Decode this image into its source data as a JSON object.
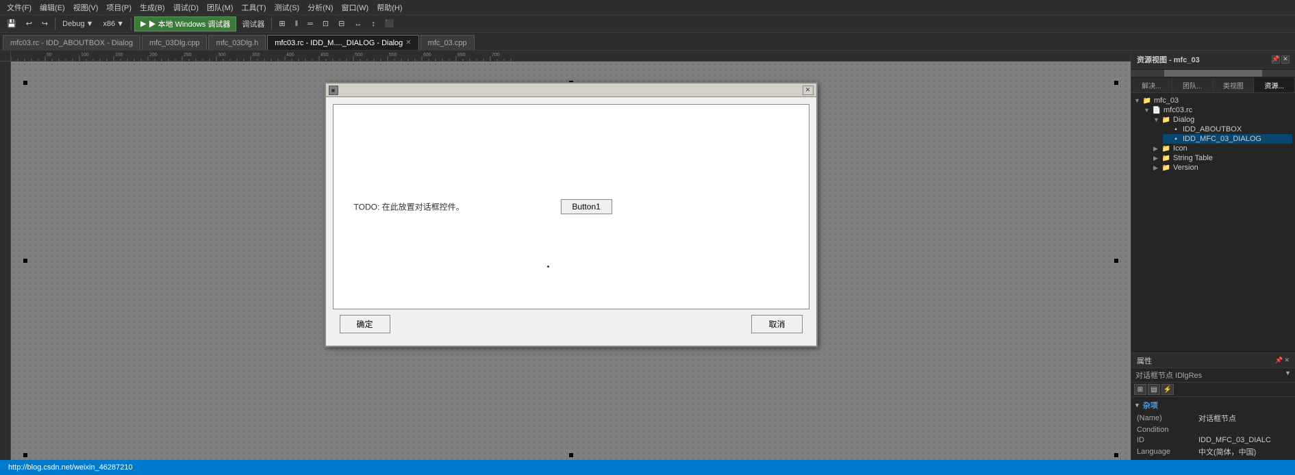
{
  "toolbar": {
    "menus": [
      "文件(F)",
      "编辑(E)",
      "视图(V)",
      "项目(P)",
      "生成(B)",
      "调试(D)",
      "团队(M)",
      "工具(T)",
      "测试(S)",
      "分析(N)",
      "窗口(W)",
      "帮助(H)"
    ],
    "debug_label": "Debug",
    "platform_label": "x86",
    "run_label": "▶ 本地 Windows 调试器",
    "attach_label": "调试器"
  },
  "tabs": [
    {
      "label": "mfc03.rc - IDD_ABOUTBOX - Dialog",
      "active": false,
      "closable": false
    },
    {
      "label": "mfc_03Dlg.cpp",
      "active": false,
      "closable": false
    },
    {
      "label": "mfc_03Dlg.h",
      "active": false,
      "closable": false
    },
    {
      "label": "mfc03.rc - IDD_M...._DIALOG - Dialog",
      "active": true,
      "closable": true
    },
    {
      "label": "mfc_03.cpp",
      "active": false,
      "closable": false
    }
  ],
  "dialog": {
    "title": "",
    "todo_text": "TODO: 在此放置对话框控件。",
    "button1_label": "Button1",
    "ok_label": "确定",
    "cancel_label": "取消"
  },
  "sidebar": {
    "title": "资源视图 - mfc_03",
    "tabs": [
      "解决...",
      "团队...",
      "类视图",
      "资源..."
    ],
    "active_tab": "资源...",
    "tree": {
      "root": "mfc_03",
      "items": [
        {
          "label": "mfc03.rc",
          "expanded": true,
          "children": [
            {
              "label": "Dialog",
              "expanded": true,
              "children": [
                {
                  "label": "IDD_ABOUTBOX"
                },
                {
                  "label": "IDD_MFC_03_DIALOG",
                  "selected": true
                }
              ]
            },
            {
              "label": "Icon",
              "expanded": false
            },
            {
              "label": "String Table",
              "expanded": false
            },
            {
              "label": "Version",
              "expanded": false
            }
          ]
        }
      ]
    }
  },
  "properties": {
    "title": "属性",
    "subtitle": "对话框节点 IDlgRes",
    "section": "杂项",
    "rows": [
      {
        "key": "(Name)",
        "value": "对话框节点"
      },
      {
        "key": "Condition",
        "value": ""
      },
      {
        "key": "ID",
        "value": "IDD_MFC_03_DIALC"
      },
      {
        "key": "Language",
        "value": "中文(简体，中国)"
      }
    ]
  },
  "status_bar": {
    "text": "http://blog.csdn.net/weixin_46287210"
  },
  "icons": {
    "chevron_right": "▶",
    "chevron_down": "▼",
    "folder": "📁",
    "file": "📄",
    "close": "✕",
    "play": "▶",
    "minimize": "─",
    "maximize": "□",
    "restore": "❌"
  }
}
